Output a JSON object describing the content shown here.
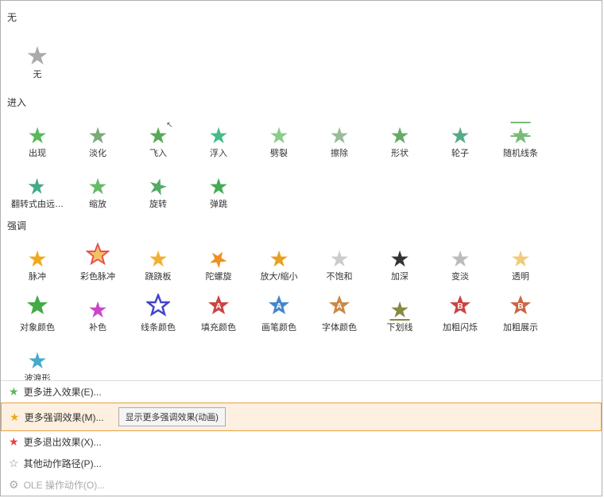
{
  "sections": [
    {
      "id": "none-section",
      "label": "无",
      "items": [
        {
          "id": "none",
          "icon": "★",
          "color": "#aaaaaa",
          "label": "无",
          "fontSize": "32px"
        }
      ]
    },
    {
      "id": "enter-section",
      "label": "进入",
      "items": [
        {
          "id": "appear",
          "icon": "★",
          "color": "#5ab85a",
          "label": "出现"
        },
        {
          "id": "fade",
          "icon": "★",
          "color": "#7aaa7a",
          "label": "淡化"
        },
        {
          "id": "fly-in",
          "icon": "★",
          "color": "#55aa55",
          "label": "飞入",
          "variant": "cursor"
        },
        {
          "id": "float-in",
          "icon": "★",
          "color": "#44bb88",
          "label": "浮入"
        },
        {
          "id": "split",
          "icon": "★",
          "color": "#88cc88",
          "label": "劈裂"
        },
        {
          "id": "erase",
          "icon": "★",
          "color": "#99bb99",
          "label": "擦除"
        },
        {
          "id": "shape",
          "icon": "★",
          "color": "#66aa66",
          "label": "形状"
        },
        {
          "id": "wheel",
          "icon": "★",
          "color": "#55aa88",
          "label": "轮子"
        },
        {
          "id": "random-line",
          "icon": "★",
          "color": "#77bb77",
          "label": "随机线条",
          "striped": true
        },
        {
          "id": "flip-far",
          "icon": "★",
          "color": "#44aa88",
          "label": "翻转式由远…",
          "rotated": true
        },
        {
          "id": "zoom",
          "icon": "★",
          "color": "#66bb66",
          "label": "缩放"
        },
        {
          "id": "rotate",
          "icon": "★",
          "color": "#55aa66",
          "label": "旋转"
        },
        {
          "id": "bounce",
          "icon": "★",
          "color": "#44aa55",
          "label": "弹跳"
        }
      ]
    },
    {
      "id": "emphasize-section",
      "label": "强调",
      "items": [
        {
          "id": "pulse",
          "icon": "★",
          "color": "#f0a820",
          "label": "脉冲"
        },
        {
          "id": "color-pulse",
          "icon": "★",
          "color": "#e85050",
          "label": "彩色脉冲",
          "multi": true
        },
        {
          "id": "teeter",
          "icon": "★",
          "color": "#f0b030",
          "label": "跷跷板"
        },
        {
          "id": "spin",
          "icon": "★",
          "color": "#f09020",
          "label": "陀螺旋",
          "spinner": true
        },
        {
          "id": "grow-shrink",
          "icon": "★",
          "color": "#e8a020",
          "label": "放大/缩小"
        },
        {
          "id": "desaturate",
          "icon": "★",
          "color": "#cccccc",
          "label": "不饱和"
        },
        {
          "id": "darken",
          "icon": "★",
          "color": "#222222",
          "label": "加深"
        },
        {
          "id": "lighten",
          "icon": "★",
          "color": "#aaaaaa",
          "label": "变淡"
        },
        {
          "id": "transparent",
          "icon": "★",
          "color": "#e8a820",
          "label": "透明"
        },
        {
          "id": "object-color",
          "icon": "★",
          "color": "#44aa44",
          "label": "对象颜色"
        },
        {
          "id": "complementary",
          "icon": "★",
          "color": "#cc44cc",
          "label": "补色"
        },
        {
          "id": "line-color",
          "icon": "★",
          "color": "#4444cc",
          "label": "线条颜色",
          "linecolor": true
        },
        {
          "id": "fill-color",
          "icon": "★",
          "color": "#cc4444",
          "label": "填充颜色",
          "fillcolor": true
        },
        {
          "id": "brush-color",
          "icon": "★",
          "color": "#4488cc",
          "label": "画笔颜色",
          "brushcolor": true
        },
        {
          "id": "font-color",
          "icon": "★",
          "color": "#cc8844",
          "label": "字体颜色",
          "fontcolor": true
        },
        {
          "id": "underline",
          "icon": "★",
          "color": "#888844",
          "label": "下划线"
        },
        {
          "id": "bold-flash",
          "icon": "★",
          "color": "#cc4444",
          "label": "加粗闪烁",
          "boldflash": true
        },
        {
          "id": "bold-reveal",
          "icon": "★",
          "color": "#cc6644",
          "label": "加粗展示",
          "boldreveal": true
        },
        {
          "id": "wave",
          "icon": "★",
          "color": "#44aacc",
          "label": "波浪形"
        }
      ]
    }
  ],
  "menu_items": [
    {
      "id": "more-enter",
      "icon": "★",
      "icon_color": "#5ab85a",
      "label": "更多进入效果(E)...",
      "disabled": false,
      "highlighted": false
    },
    {
      "id": "more-emphasize",
      "icon": "★",
      "icon_color": "#f0a820",
      "label": "更多强调效果(M)...",
      "disabled": false,
      "highlighted": true,
      "tooltip_button": "显示更多强调效果(动画)"
    },
    {
      "id": "more-exit",
      "icon": "★",
      "icon_color": "#e84040",
      "label": "更多退出效果(X)...",
      "disabled": false,
      "highlighted": false
    },
    {
      "id": "motion-path",
      "icon": "☆",
      "icon_color": "#888888",
      "label": "其他动作路径(P)...",
      "disabled": false,
      "highlighted": false
    },
    {
      "id": "ole-action",
      "icon": "⚙",
      "icon_color": "#aaaaaa",
      "label": "OLE 操作动作(O)...",
      "disabled": true,
      "highlighted": false
    }
  ]
}
